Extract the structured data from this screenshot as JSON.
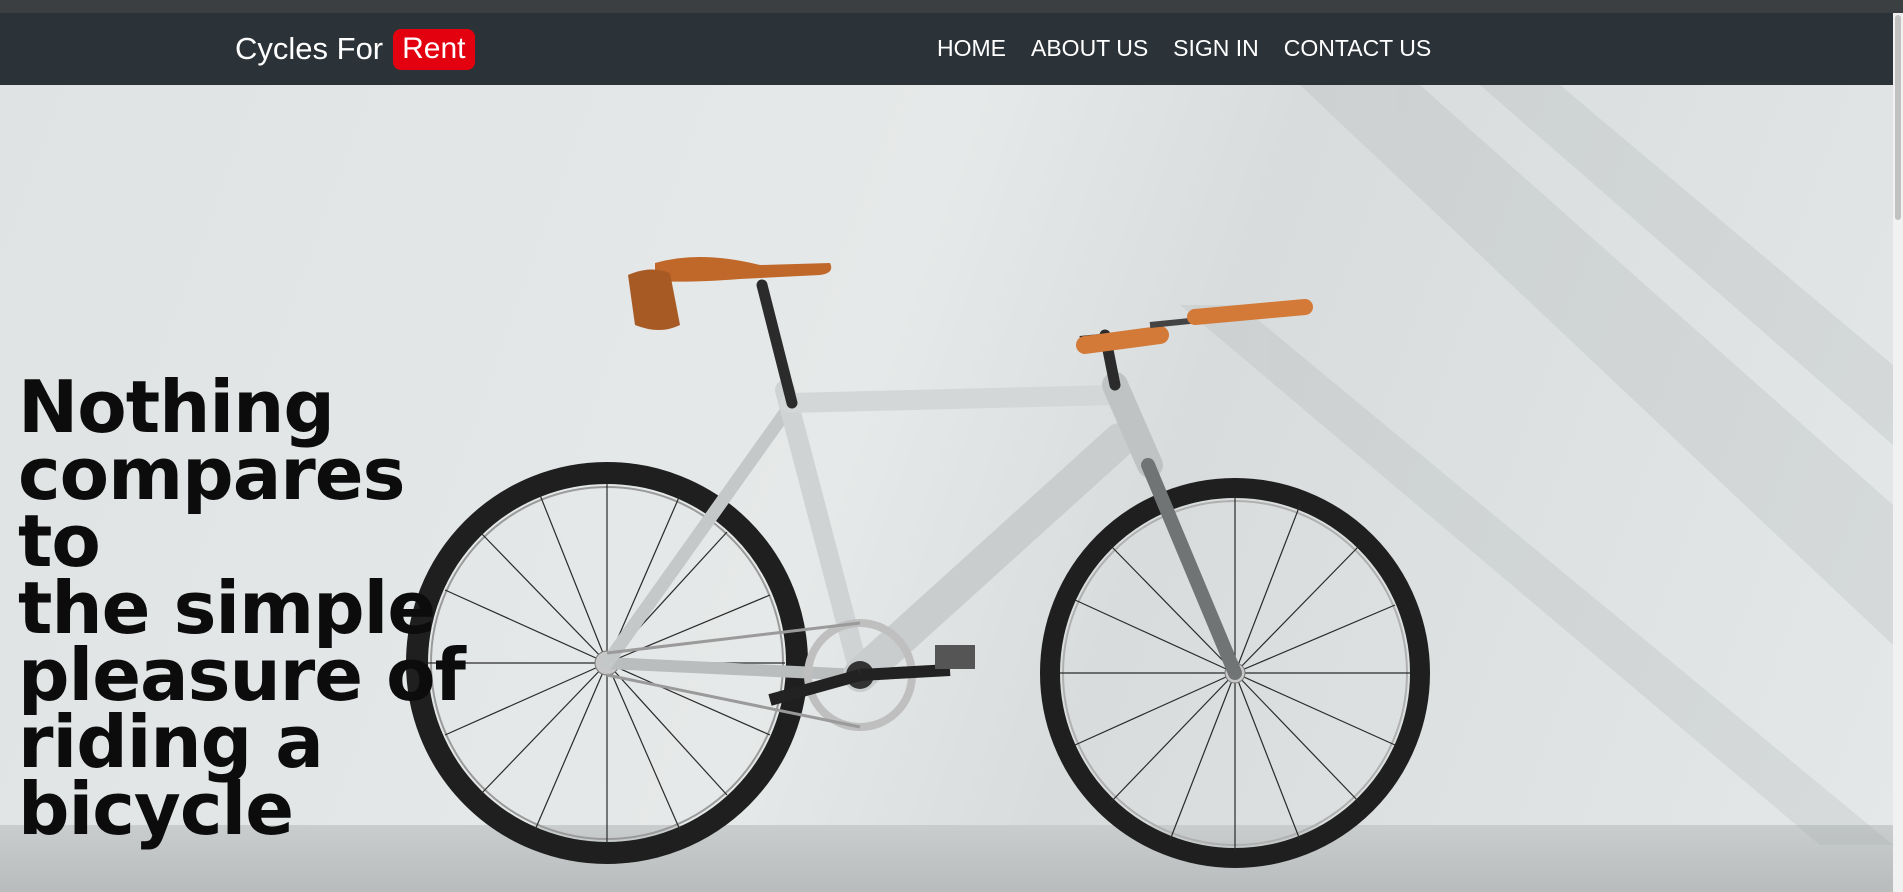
{
  "brand": {
    "name": "Cycles For",
    "badge": "Rent"
  },
  "nav": {
    "items": [
      "HOME",
      "ABOUT US",
      "SIGN IN",
      "CONTACT US"
    ]
  },
  "hero": {
    "headline_lines": [
      "Nothing",
      "compares to",
      "the simple",
      "pleasure of",
      "riding a",
      "bicycle"
    ],
    "image": "bicycle-photo"
  },
  "colors": {
    "navbar": "#2b3338",
    "badge": "#e3000f",
    "text": "#ffffff",
    "headline": "#0c0c0c"
  }
}
